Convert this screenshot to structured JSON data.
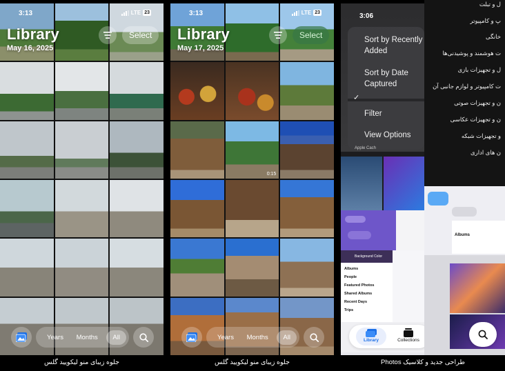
{
  "phones": [
    {
      "time": "3:13",
      "signal": "LTE",
      "battery": "23",
      "title": "Library",
      "date": "May 16, 2025",
      "select_label": "Select",
      "tabs": {
        "years": "Years",
        "months": "Months",
        "all": "All"
      }
    },
    {
      "time": "3:13",
      "signal": "LTE",
      "battery": "23",
      "title": "Library",
      "date": "May 17, 2025",
      "select_label": "Select",
      "tabs": {
        "years": "Years",
        "months": "Months",
        "all": "All"
      },
      "video_duration": "0:15"
    },
    {
      "time": "3:06",
      "menu": {
        "sort_recent": "Sort by Recently Added",
        "sort_date": "Sort by Date Captured",
        "filter": "Filter",
        "view_options": "View Options"
      },
      "photo_label": "Apple Cach",
      "sheet": {
        "header": "Background Color",
        "rows": [
          "Albums",
          "People",
          "Featured Photos",
          "Shared Albums",
          "Recent Days",
          "Trips"
        ]
      },
      "albums_label": "Albums",
      "tabs": {
        "library": "Library",
        "collections": "Collections"
      }
    }
  ],
  "captions": [
    "جلوه زیبای منو لیکویید گلس",
    "جلوه زیبای منو لیکویید گلس",
    "طراحی جدید و کلاسیک Photos"
  ],
  "side_menu": [
    "ل و تبلت",
    "پ و کامپیوتر",
    "خانگی",
    "ت هوشمند و پوشیدنی‌ها",
    "ل و تجهیزات بازی",
    "ت کامپیوتر و لوازم جانبی آن",
    "ن و تجهیزات صوتی",
    "ن و تجهیزات عکاسی",
    "و تجهیزات شبکه",
    "ن های اداری"
  ],
  "colors": {
    "accent_blue": "#1b6fe6",
    "glass": "rgba(255,255,255,0.25)",
    "select_green": "#387846"
  },
  "icons": [
    "hamburger-menu-icon",
    "photo-stack-icon",
    "search-icon",
    "checkmark-icon",
    "collections-icon"
  ]
}
